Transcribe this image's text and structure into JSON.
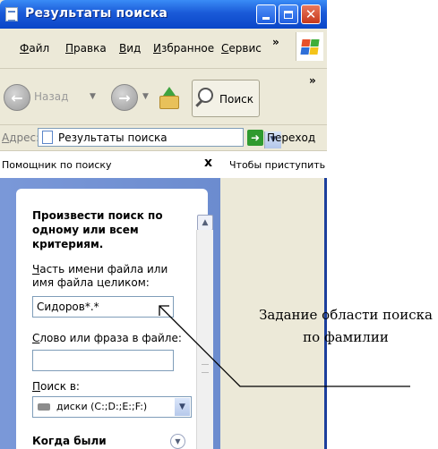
{
  "window": {
    "title": "Результаты поиска"
  },
  "menu": {
    "items": [
      {
        "hotkey": "Ф",
        "rest": "айл"
      },
      {
        "hotkey": "П",
        "rest": "равка"
      },
      {
        "hotkey": "В",
        "rest": "ид"
      },
      {
        "hotkey": "И",
        "rest": "збранное"
      },
      {
        "hotkey": "С",
        "rest": "ервис"
      }
    ],
    "more": "»"
  },
  "toolbar": {
    "back_label": "Назад",
    "search_label": "Поиск",
    "more": "»"
  },
  "address": {
    "label_hotkey": "А",
    "label_rest": "дрес:",
    "value": "Результаты поиска",
    "go_label": "Переход"
  },
  "pane": {
    "title": "Помощник по поиску",
    "close": "x",
    "right_hint": "Чтобы приступить к"
  },
  "assistant": {
    "heading": "Произвести поиск по одному или всем критериям.",
    "filename_label_hotkey": "Ч",
    "filename_label_rest": "асть имени файла или имя файла целиком:",
    "filename_value": "Сидоров*.*",
    "phrase_label_hotkey": "С",
    "phrase_label_rest": "лово или фраза в файле:",
    "phrase_value": "",
    "lookin_label_hotkey": "П",
    "lookin_label_rest": "оиск в:",
    "lookin_value": "диски (C:;D:;E:;F:)",
    "when_label": "Когда были"
  },
  "annotation": {
    "text": "Задание области поиска по фамилии"
  },
  "colors": {
    "titlebar": "#1a5ad8",
    "side_pane": "#6f8fd0",
    "close_button": "#c6381c"
  }
}
